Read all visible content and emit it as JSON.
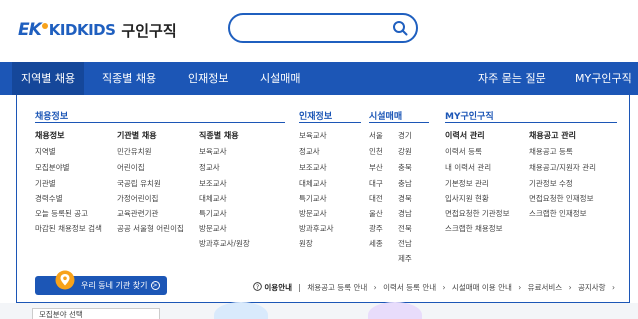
{
  "logo": {
    "ek": "EK",
    "kidkids": "KIDKIDS",
    "sub": "구인구직"
  },
  "search": {
    "placeholder": "",
    "value": ""
  },
  "nav": {
    "items": [
      "지역별 채용",
      "직종별 채용",
      "인재정보",
      "시설매매"
    ],
    "right": [
      "자주 묻는 질문",
      "MY구인구직"
    ]
  },
  "sections": {
    "job_info": "채용정보",
    "talent": "인재정보",
    "facility": "시설매매",
    "my": "MY구인구직"
  },
  "job_cols": [
    {
      "head": "채용정보",
      "items": [
        "지역별",
        "모집분야별",
        "기관별",
        "경력수별",
        "오늘 등록된 공고",
        "마감된 채용정보 검색"
      ]
    },
    {
      "head": "기관별 채용",
      "items": [
        "민간유치원",
        "어린이집",
        "국공립 유치원",
        "가정어린이집",
        "교육관련기관",
        "공공 서울형 어린이집"
      ]
    },
    {
      "head": "직종별 채용",
      "items": [
        "보육교사",
        "정교사",
        "보조교사",
        "대체교사",
        "특기교사",
        "방문교사",
        "방과후교사/원장"
      ]
    }
  ],
  "talent_items": [
    "보육교사",
    "정교사",
    "보조교사",
    "대체교사",
    "특기교사",
    "방문교사",
    "방과후교사",
    "원장"
  ],
  "facility_left": [
    "서울",
    "인천",
    "부산",
    "대구",
    "대전",
    "울산",
    "광주",
    "세종"
  ],
  "facility_right": [
    "경기",
    "강원",
    "충북",
    "충남",
    "경북",
    "경남",
    "전북",
    "전남",
    "제주"
  ],
  "my_cols": [
    {
      "head": "이력서 관리",
      "items": [
        "이력서 등록",
        "내 이력서 관리",
        "기본정보 관리",
        "입사지원 현황",
        "면접요청한 기관정보",
        "스크랩한 채용정보"
      ]
    },
    {
      "head": "채용공고 관리",
      "items": [
        "채용공고 등록",
        "채용공고/지원자 관리",
        "기관정보 수정",
        "면접요청한 인재정보",
        "스크랩한 인재정보"
      ]
    }
  ],
  "location_button": {
    "label": "우리 동네 기관 찾기",
    "arrow": ">"
  },
  "footer": {
    "guide": "이용안내",
    "links": [
      "채용공고 등록 안내",
      "이력서 등록 안내",
      "시설매매 이용 안내",
      "유료서비스",
      "공지사항"
    ]
  },
  "below": {
    "select_label": "모집분야 선택"
  },
  "colors": {
    "brand": "#1c56b6",
    "nav_active": "#15479a",
    "logo_accent": "#f7a21b"
  }
}
